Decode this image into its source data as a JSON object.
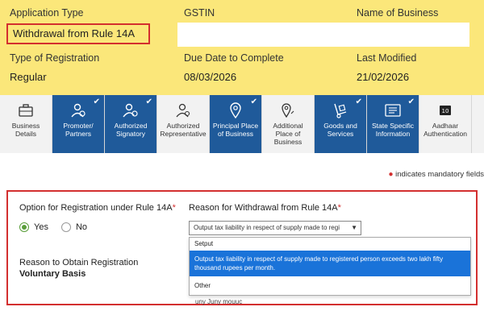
{
  "header": {
    "application_type_label": "Application Type",
    "application_type_value": "Withdrawal from Rule 14A",
    "gstin_label": "GSTIN",
    "gstin_value": "",
    "business_name_label": "Name of Business",
    "registration_type_label": "Type of Registration",
    "registration_type_value": "Regular",
    "due_date_label": "Due Date to Complete",
    "due_date_value": "08/03/2026",
    "last_modified_label": "Last Modified",
    "last_modified_value": "21/02/2026"
  },
  "tabs": [
    {
      "label": "Business Details",
      "state": "plain",
      "icon": "briefcase-icon"
    },
    {
      "label": "Promoter/ Partners",
      "state": "done",
      "icon": "person-group-icon"
    },
    {
      "label": "Authorized Signatory",
      "state": "done",
      "icon": "person-gear-icon"
    },
    {
      "label": "Authorized Representative",
      "state": "plain",
      "icon": "person-outline-icon"
    },
    {
      "label": "Principal Place of Business",
      "state": "done",
      "icon": "map-pin-icon"
    },
    {
      "label": "Additional Place of Business",
      "state": "plain",
      "icon": "map-pins-icon"
    },
    {
      "label": "Goods and Services",
      "state": "done",
      "icon": "hand-truck-icon"
    },
    {
      "label": "State Specific Information",
      "state": "done",
      "icon": "info-card-icon"
    },
    {
      "label": "Aadhaar Authentication",
      "state": "plain",
      "icon": "id-badge-icon"
    }
  ],
  "mandatory_note": "indicates mandatory fields",
  "form": {
    "option_label": "Option for Registration under Rule 14A",
    "option_yes": "Yes",
    "option_no": "No",
    "option_selected": "Yes",
    "withdrawal_reason_label": "Reason for Withdrawal from Rule 14A",
    "withdrawal_reason_selected": "Output tax liability in respect of supply made to regi",
    "dropdown_options": [
      "Setput",
      "Output tax liability in respect of supply made to registered person exceeds two lakh fifty thousand rupees per month.",
      "Other"
    ],
    "obtain_reason_label": "Reason to Obtain Registration",
    "obtain_reason_value": "Voluntary Basis",
    "partial_text": "uny Juny mouuc"
  },
  "colors": {
    "header_bg": "#fbe77a",
    "tab_done_bg": "#1f5a9a",
    "highlight_border": "#d32f2f",
    "dropdown_selected_bg": "#1a73d9",
    "radio_on": "#5a9e3a"
  }
}
